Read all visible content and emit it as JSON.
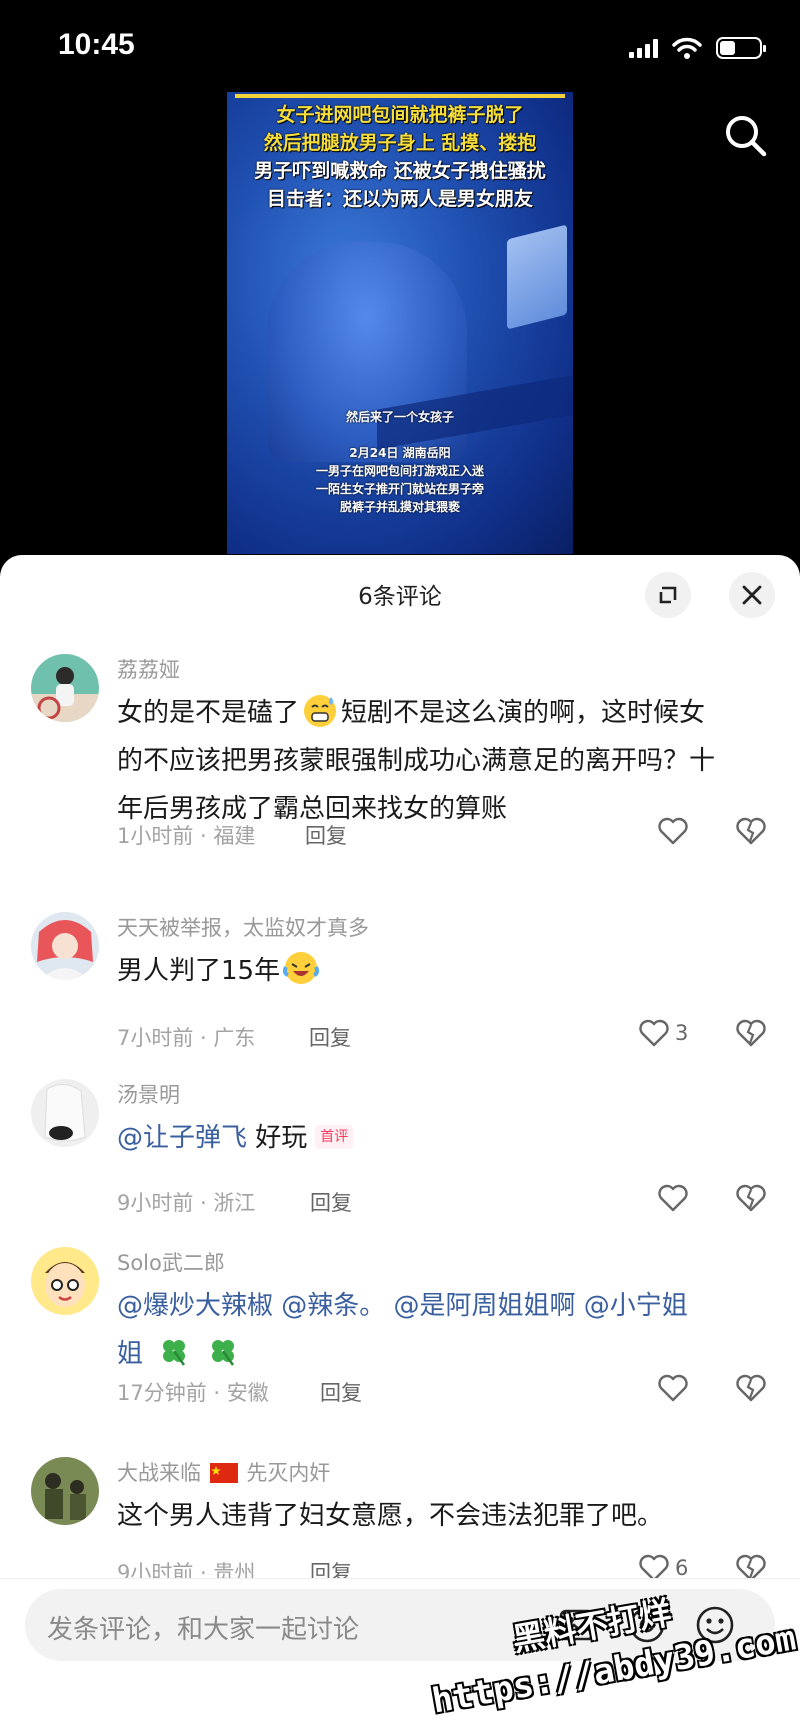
{
  "status_bar": {
    "time": "10:45"
  },
  "video": {
    "headline_lines": [
      "女子进网吧包间就把裤子脱了",
      "然后把腿放男子身上 乱摸、搂抱",
      "男子吓到喊救命 还被女子拽住骚扰",
      "目击者：还以为两人是男女朋友"
    ],
    "subtitle_lines": [
      "然后来了一个女孩子",
      "2月24日 湖南岳阳",
      "一男子在网吧包间打游戏正入迷",
      "一陌生女子推开门就站在男子旁",
      "脱裤子并乱摸对其猥亵"
    ]
  },
  "sheet": {
    "title": "6条评论"
  },
  "comments": [
    {
      "user": "荔荔娅",
      "line1": "女的是不是磕了",
      "line1b": "短剧不是这么演的啊，这时候女",
      "line2": "的不应该把男孩蒙眼强制成功心满意足的离开吗？十",
      "line3": "年后男孩成了霸总回来找女的算账",
      "meta": "1小时前 · 福建",
      "reply": "回复",
      "likes": ""
    },
    {
      "user": "天天被举报，太监奴才真多",
      "line1": "男人判了15年",
      "meta": "7小时前 · 广东",
      "reply": "回复",
      "likes": "3"
    },
    {
      "user": "汤景明",
      "mention": "@让子弹飞",
      "line1": " 好玩",
      "badge": "首评",
      "meta": "9小时前 · 浙江",
      "reply": "回复",
      "likes": ""
    },
    {
      "user": "Solo武二郎",
      "line1": "@爆炒大辣椒 @辣条。 @是阿周姐姐啊 @小宁姐",
      "line2": "姐",
      "meta": "17分钟前 · 安徽",
      "reply": "回复",
      "likes": ""
    },
    {
      "user_a": "大战来临",
      "user_b": "先灭内奸",
      "line1": "这个男人违背了妇女意愿，不会违法犯罪了吧。",
      "meta": "9小时前 · 贵州",
      "reply": "回复",
      "likes": "6"
    }
  ],
  "input": {
    "placeholder": "发条评论，和大家一起讨论"
  },
  "watermark": {
    "line1": "黑料不打烊",
    "line2": "https://abdy39.com"
  },
  "colors": {
    "mention": "#3a5f9f",
    "video_blue": "#1f4fb0",
    "caption_yellow": "#f6de3c",
    "badge_red": "#ff3a60"
  },
  "icons": [
    "search-icon",
    "expand-icon",
    "close-icon",
    "heart-outline-icon",
    "heart-broken-icon",
    "emoji-sweat-icon",
    "emoji-laugh-cry-icon",
    "clover-icon",
    "flag-cn-icon",
    "image-icon",
    "at-icon",
    "smiley-icon"
  ]
}
